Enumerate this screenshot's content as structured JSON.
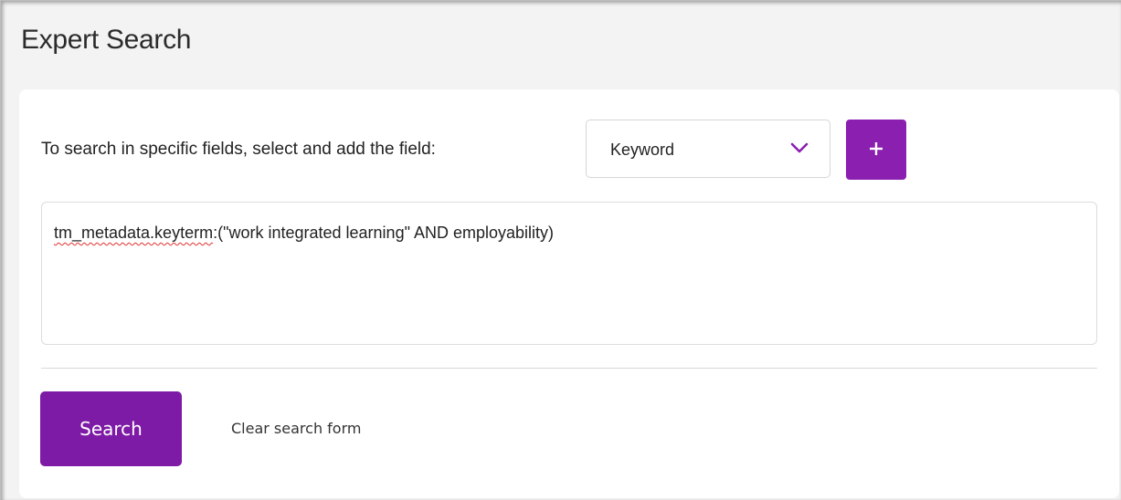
{
  "page": {
    "title": "Expert Search"
  },
  "field_picker": {
    "label": "To search in specific fields, select and add the field:",
    "selected": "Keyword",
    "chevron_icon": "chevron-down-icon",
    "add_icon": "plus-icon"
  },
  "query": {
    "prefix": "tm_metadata.keyterm",
    "rest": ":(\"work integrated learning\" AND employability)"
  },
  "actions": {
    "search_label": "Search",
    "clear_label": "Clear search form"
  },
  "colors": {
    "accent": "#7d1aa6",
    "background": "#f3f3f3",
    "card": "#ffffff",
    "spell_error": "#e03030"
  }
}
